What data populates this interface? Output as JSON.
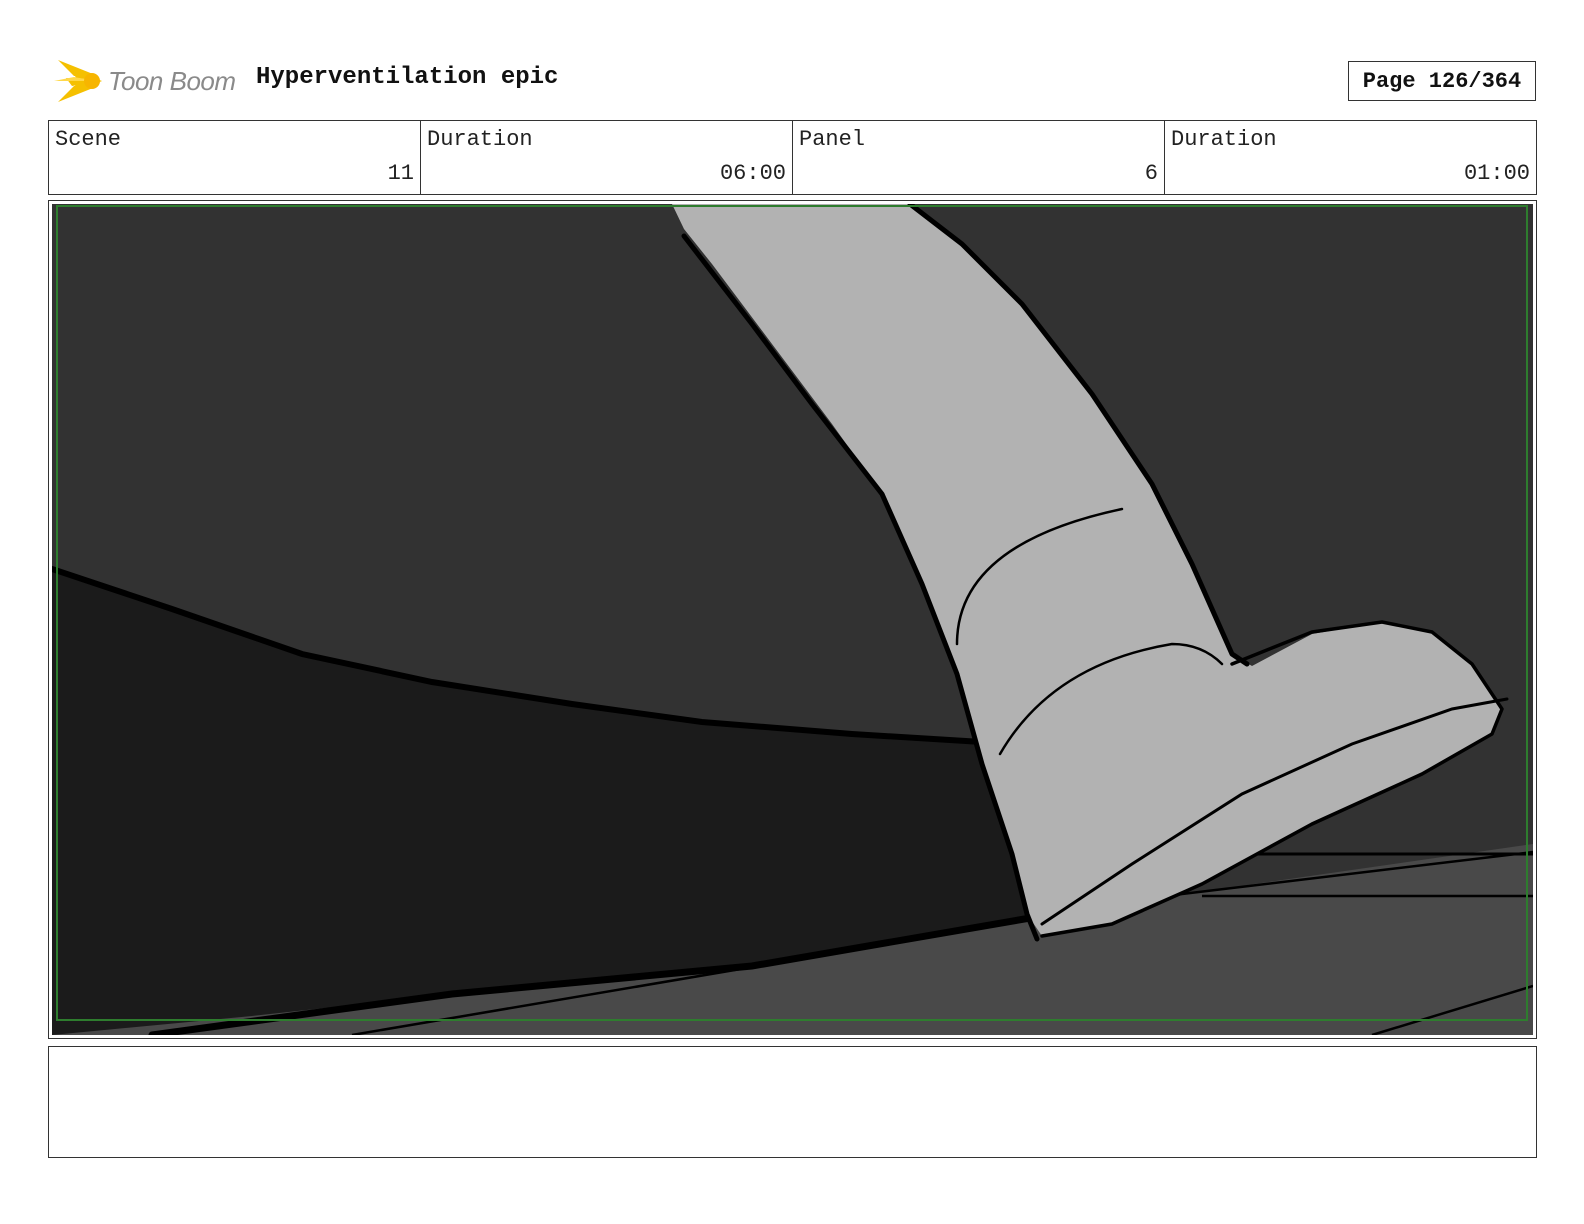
{
  "header": {
    "logo_text": "Toon Boom",
    "project_title": "Hyperventilation epic",
    "page_label": "Page 126/364"
  },
  "info": {
    "scene_label": "Scene",
    "scene_value": "11",
    "scene_duration_label": "Duration",
    "scene_duration_value": "06:00",
    "panel_label": "Panel",
    "panel_value": "6",
    "panel_duration_label": "Duration",
    "panel_duration_value": "01:00"
  },
  "panel": {
    "image_icon": "storyboard-sketch-boot-stepping",
    "colors": {
      "background": "#323232",
      "shadow": "#1b1b1b",
      "floor": "#494949",
      "boot": "#b2b2b2",
      "safe_frame": "#2e7d2e"
    }
  },
  "notes": {
    "text": ""
  }
}
